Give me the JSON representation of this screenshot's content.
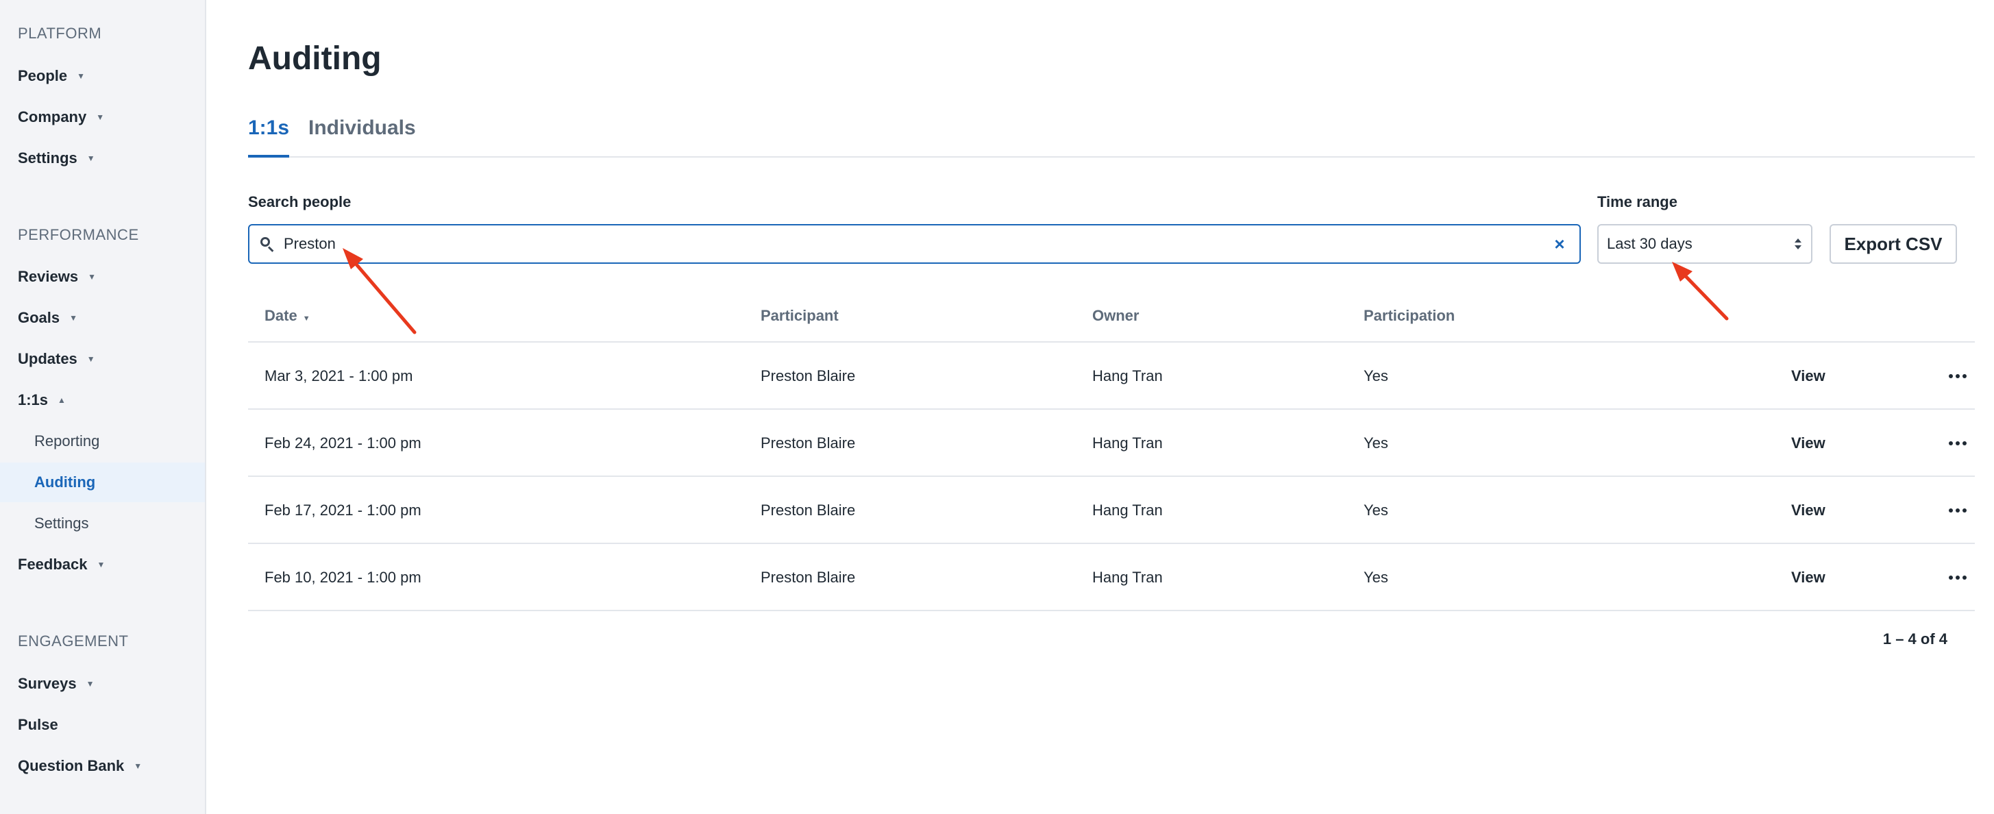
{
  "sidebar": {
    "platform_heading": "PLATFORM",
    "platform_items": [
      {
        "label": "People",
        "caret": "▼"
      },
      {
        "label": "Company",
        "caret": "▼"
      },
      {
        "label": "Settings",
        "caret": "▼"
      }
    ],
    "performance_heading": "PERFORMANCE",
    "performance_items": [
      {
        "label": "Reviews",
        "caret": "▼"
      },
      {
        "label": "Goals",
        "caret": "▼"
      },
      {
        "label": "Updates",
        "caret": "▼"
      },
      {
        "label": "1:1s",
        "caret": "▲"
      }
    ],
    "oneonone_subitems": [
      "Reporting",
      "Auditing",
      "Settings"
    ],
    "active_subitem": "Auditing",
    "feedback_item": {
      "label": "Feedback",
      "caret": "▼"
    },
    "engagement_heading": "ENGAGEMENT",
    "engagement_items": [
      {
        "label": "Surveys",
        "caret": "▼"
      },
      {
        "label": "Pulse",
        "caret": ""
      },
      {
        "label": "Question Bank",
        "caret": "▼"
      }
    ]
  },
  "main": {
    "title": "Auditing",
    "tabs": [
      {
        "label": "1:1s",
        "active": true
      },
      {
        "label": "Individuals",
        "active": false
      }
    ],
    "search": {
      "label": "Search people",
      "value": "Preston",
      "clear_icon": "×"
    },
    "time_range": {
      "label": "Time range",
      "selected": "Last 30 days"
    },
    "export_label": "Export CSV",
    "table": {
      "columns": [
        "Date",
        "Participant",
        "Owner",
        "Participation"
      ],
      "sort_caret": "▼",
      "rows": [
        {
          "date": "Mar 3, 2021 - 1:00 pm",
          "participant": "Preston Blaire",
          "owner": "Hang Tran",
          "participation": "Yes",
          "action": "View"
        },
        {
          "date": "Feb 24, 2021 - 1:00 pm",
          "participant": "Preston Blaire",
          "owner": "Hang Tran",
          "participation": "Yes",
          "action": "View"
        },
        {
          "date": "Feb 17, 2021 - 1:00 pm",
          "participant": "Preston Blaire",
          "owner": "Hang Tran",
          "participation": "Yes",
          "action": "View"
        },
        {
          "date": "Feb 10, 2021 - 1:00 pm",
          "participant": "Preston Blaire",
          "owner": "Hang Tran",
          "participation": "Yes",
          "action": "View"
        }
      ]
    },
    "pagination": "1 – 4 of 4"
  },
  "colors": {
    "accent": "#1a66b8",
    "annotation_arrow": "#e8391d",
    "sidebar_bg": "#f3f4f7"
  }
}
